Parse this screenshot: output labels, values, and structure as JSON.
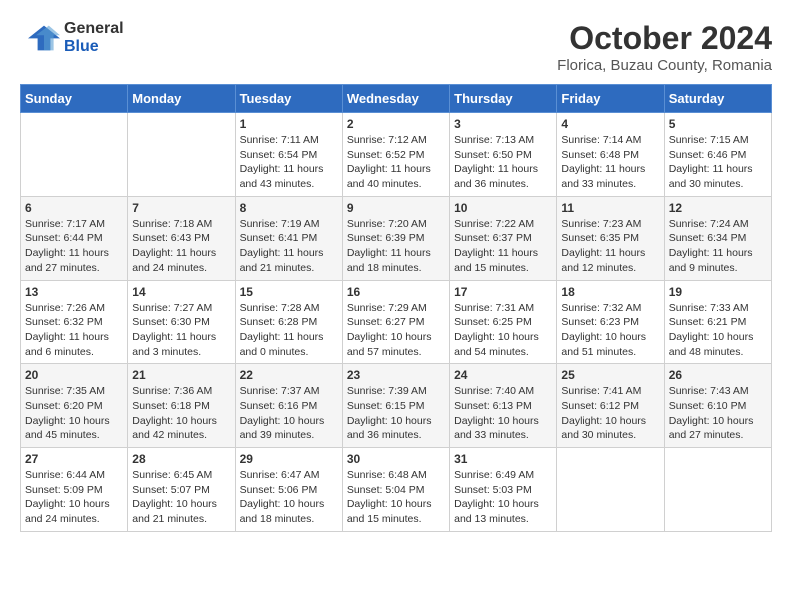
{
  "header": {
    "logo_general": "General",
    "logo_blue": "Blue",
    "month": "October 2024",
    "location": "Florica, Buzau County, Romania"
  },
  "weekdays": [
    "Sunday",
    "Monday",
    "Tuesday",
    "Wednesday",
    "Thursday",
    "Friday",
    "Saturday"
  ],
  "weeks": [
    [
      {
        "day": "",
        "info": ""
      },
      {
        "day": "",
        "info": ""
      },
      {
        "day": "1",
        "info": "Sunrise: 7:11 AM\nSunset: 6:54 PM\nDaylight: 11 hours and 43 minutes."
      },
      {
        "day": "2",
        "info": "Sunrise: 7:12 AM\nSunset: 6:52 PM\nDaylight: 11 hours and 40 minutes."
      },
      {
        "day": "3",
        "info": "Sunrise: 7:13 AM\nSunset: 6:50 PM\nDaylight: 11 hours and 36 minutes."
      },
      {
        "day": "4",
        "info": "Sunrise: 7:14 AM\nSunset: 6:48 PM\nDaylight: 11 hours and 33 minutes."
      },
      {
        "day": "5",
        "info": "Sunrise: 7:15 AM\nSunset: 6:46 PM\nDaylight: 11 hours and 30 minutes."
      }
    ],
    [
      {
        "day": "6",
        "info": "Sunrise: 7:17 AM\nSunset: 6:44 PM\nDaylight: 11 hours and 27 minutes."
      },
      {
        "day": "7",
        "info": "Sunrise: 7:18 AM\nSunset: 6:43 PM\nDaylight: 11 hours and 24 minutes."
      },
      {
        "day": "8",
        "info": "Sunrise: 7:19 AM\nSunset: 6:41 PM\nDaylight: 11 hours and 21 minutes."
      },
      {
        "day": "9",
        "info": "Sunrise: 7:20 AM\nSunset: 6:39 PM\nDaylight: 11 hours and 18 minutes."
      },
      {
        "day": "10",
        "info": "Sunrise: 7:22 AM\nSunset: 6:37 PM\nDaylight: 11 hours and 15 minutes."
      },
      {
        "day": "11",
        "info": "Sunrise: 7:23 AM\nSunset: 6:35 PM\nDaylight: 11 hours and 12 minutes."
      },
      {
        "day": "12",
        "info": "Sunrise: 7:24 AM\nSunset: 6:34 PM\nDaylight: 11 hours and 9 minutes."
      }
    ],
    [
      {
        "day": "13",
        "info": "Sunrise: 7:26 AM\nSunset: 6:32 PM\nDaylight: 11 hours and 6 minutes."
      },
      {
        "day": "14",
        "info": "Sunrise: 7:27 AM\nSunset: 6:30 PM\nDaylight: 11 hours and 3 minutes."
      },
      {
        "day": "15",
        "info": "Sunrise: 7:28 AM\nSunset: 6:28 PM\nDaylight: 11 hours and 0 minutes."
      },
      {
        "day": "16",
        "info": "Sunrise: 7:29 AM\nSunset: 6:27 PM\nDaylight: 10 hours and 57 minutes."
      },
      {
        "day": "17",
        "info": "Sunrise: 7:31 AM\nSunset: 6:25 PM\nDaylight: 10 hours and 54 minutes."
      },
      {
        "day": "18",
        "info": "Sunrise: 7:32 AM\nSunset: 6:23 PM\nDaylight: 10 hours and 51 minutes."
      },
      {
        "day": "19",
        "info": "Sunrise: 7:33 AM\nSunset: 6:21 PM\nDaylight: 10 hours and 48 minutes."
      }
    ],
    [
      {
        "day": "20",
        "info": "Sunrise: 7:35 AM\nSunset: 6:20 PM\nDaylight: 10 hours and 45 minutes."
      },
      {
        "day": "21",
        "info": "Sunrise: 7:36 AM\nSunset: 6:18 PM\nDaylight: 10 hours and 42 minutes."
      },
      {
        "day": "22",
        "info": "Sunrise: 7:37 AM\nSunset: 6:16 PM\nDaylight: 10 hours and 39 minutes."
      },
      {
        "day": "23",
        "info": "Sunrise: 7:39 AM\nSunset: 6:15 PM\nDaylight: 10 hours and 36 minutes."
      },
      {
        "day": "24",
        "info": "Sunrise: 7:40 AM\nSunset: 6:13 PM\nDaylight: 10 hours and 33 minutes."
      },
      {
        "day": "25",
        "info": "Sunrise: 7:41 AM\nSunset: 6:12 PM\nDaylight: 10 hours and 30 minutes."
      },
      {
        "day": "26",
        "info": "Sunrise: 7:43 AM\nSunset: 6:10 PM\nDaylight: 10 hours and 27 minutes."
      }
    ],
    [
      {
        "day": "27",
        "info": "Sunrise: 6:44 AM\nSunset: 5:09 PM\nDaylight: 10 hours and 24 minutes."
      },
      {
        "day": "28",
        "info": "Sunrise: 6:45 AM\nSunset: 5:07 PM\nDaylight: 10 hours and 21 minutes."
      },
      {
        "day": "29",
        "info": "Sunrise: 6:47 AM\nSunset: 5:06 PM\nDaylight: 10 hours and 18 minutes."
      },
      {
        "day": "30",
        "info": "Sunrise: 6:48 AM\nSunset: 5:04 PM\nDaylight: 10 hours and 15 minutes."
      },
      {
        "day": "31",
        "info": "Sunrise: 6:49 AM\nSunset: 5:03 PM\nDaylight: 10 hours and 13 minutes."
      },
      {
        "day": "",
        "info": ""
      },
      {
        "day": "",
        "info": ""
      }
    ]
  ]
}
